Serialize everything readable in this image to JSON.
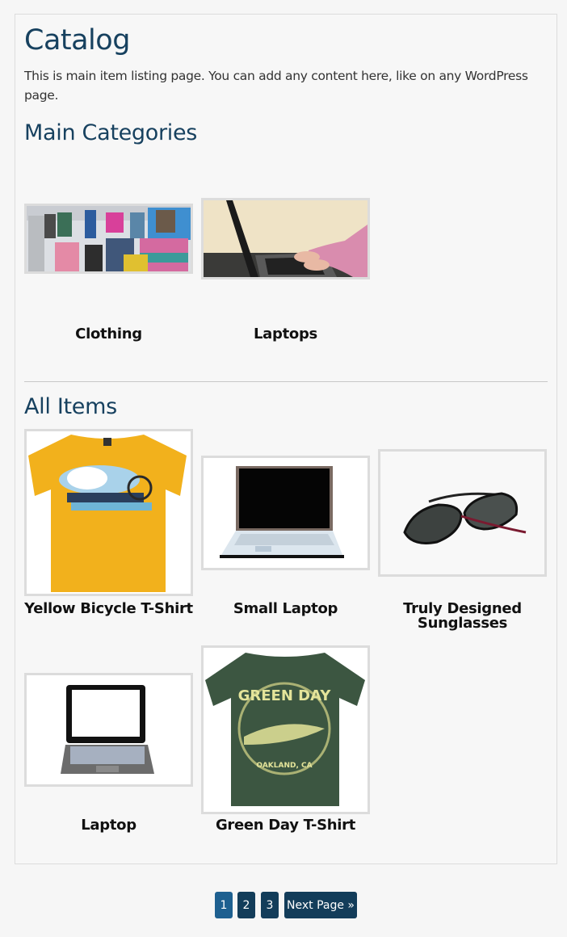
{
  "page": {
    "title": "Catalog",
    "intro": "This is main item listing page. You can add any content here, like on any WordPress page."
  },
  "categories": {
    "heading": "Main Categories",
    "items": [
      {
        "name": "Clothing",
        "image": "clothing-store-photo"
      },
      {
        "name": "Laptops",
        "image": "typing-on-laptop-photo"
      }
    ]
  },
  "items": {
    "heading": "All Items",
    "list": [
      {
        "name": "Yellow Bicycle T-Shirt",
        "image": "yellow-tshirt-photo"
      },
      {
        "name": "Small Laptop",
        "image": "small-laptop-photo"
      },
      {
        "name": "Truly Designed Sunglasses",
        "image": "sunglasses-photo"
      },
      {
        "name": "Laptop",
        "image": "laptop-photo"
      },
      {
        "name": "Green Day T-Shirt",
        "image": "green-tshirt-photo"
      }
    ]
  },
  "pagination": {
    "pages": [
      "1",
      "2",
      "3"
    ],
    "current": "1",
    "next_label": "Next Page »"
  },
  "colors": {
    "heading": "#17415f",
    "pager_active": "#1e6090",
    "pager": "#133d5a"
  }
}
